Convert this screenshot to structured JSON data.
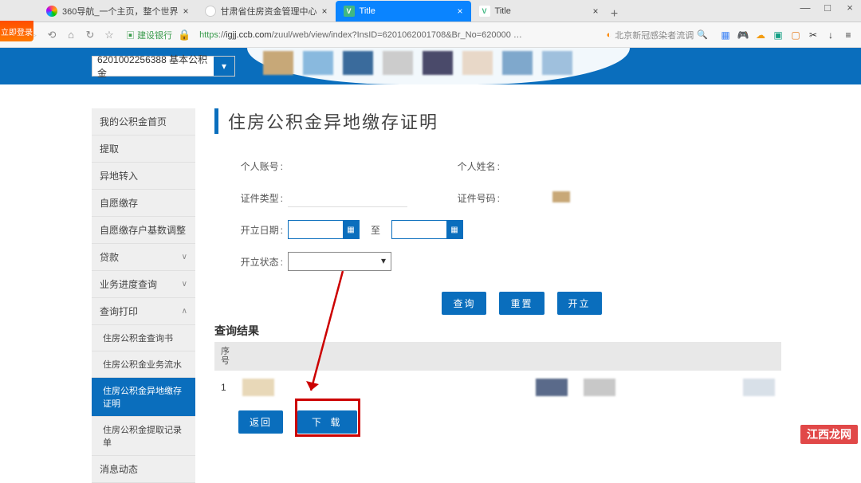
{
  "browser": {
    "tabs": [
      {
        "label": "360导航_一个主页，整个世界"
      },
      {
        "label": "甘肃省住房资金管理中心"
      },
      {
        "label": "Title"
      },
      {
        "label": "Title"
      }
    ],
    "new_tab": "+",
    "window": {
      "minimize": "—",
      "maximize": "□",
      "close": "×"
    }
  },
  "toolbar": {
    "prefix_label": "建设银行",
    "url_https": "https",
    "url_domain": "igjj.ccb.com",
    "url_path": "/zuul/web/view/index?InsID=6201062001708&Br_No=620000",
    "search_placeholder": "北京新冠感染者流调"
  },
  "login_badge": "立即登录",
  "account_select": "6201002256388 基本公积金",
  "sidebar": {
    "items": [
      {
        "label": "我的公积金首页"
      },
      {
        "label": "提取"
      },
      {
        "label": "异地转入"
      },
      {
        "label": "自愿缴存"
      },
      {
        "label": "自愿缴存户基数调整"
      },
      {
        "label": "贷款",
        "chev": "∨"
      },
      {
        "label": "业务进度查询",
        "chev": "∨"
      },
      {
        "label": "查询打印",
        "chev": "∧"
      },
      {
        "label": "住房公积金查询书",
        "sub": true
      },
      {
        "label": "住房公积金业务流水",
        "sub": true
      },
      {
        "label": "住房公积金异地缴存证明",
        "sub": true,
        "active": true
      },
      {
        "label": "住房公积金提取记录单",
        "sub": true
      },
      {
        "label": "消息动态"
      }
    ]
  },
  "main": {
    "title": "住房公积金异地缴存证明",
    "labels": {
      "personal_account": "个人账号",
      "personal_name": "个人姓名",
      "cert_type": "证件类型",
      "cert_number": "证件号码",
      "open_date": "开立日期",
      "to": "至",
      "open_status": "开立状态"
    },
    "buttons": {
      "query": "查询",
      "reset": "重置",
      "open": "开立",
      "back": "返回",
      "download": "下 载"
    },
    "result_title": "查询结果",
    "table": {
      "col_seq": "序号",
      "row1_seq": "1"
    }
  },
  "watermark": "江西龙网"
}
